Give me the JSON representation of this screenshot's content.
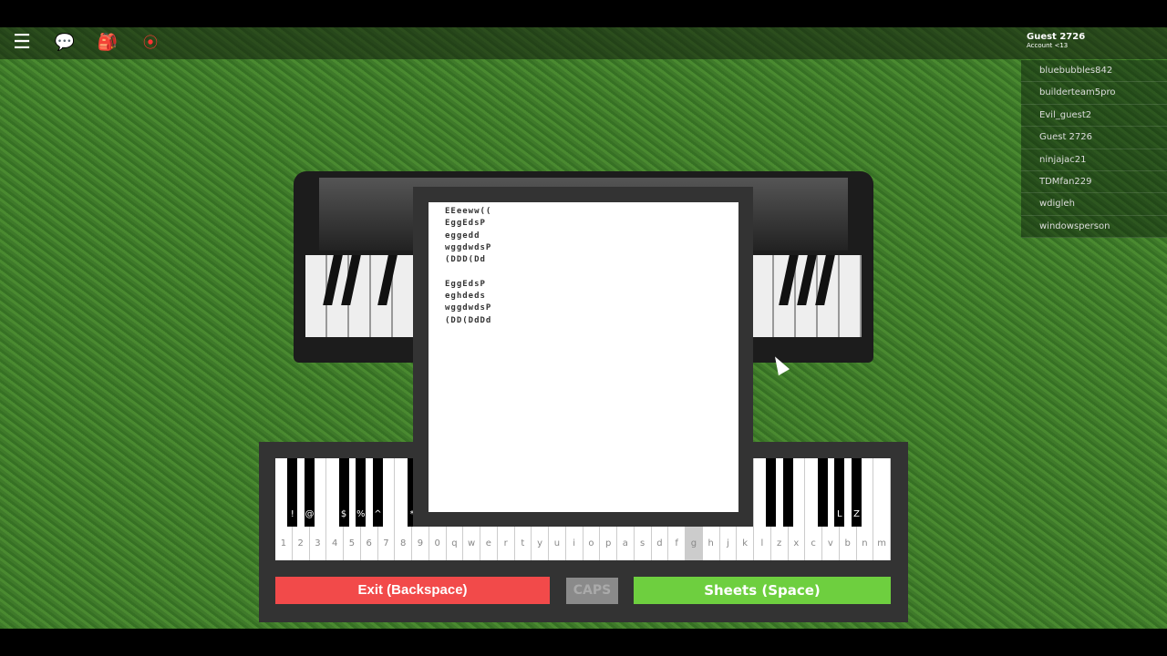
{
  "topbar": {
    "icons": [
      "menu-icon",
      "chat-icon",
      "backpack-icon",
      "record-icon"
    ]
  },
  "account": {
    "name": "Guest 2726",
    "subtitle": "Account <13"
  },
  "players": [
    "bluebubbles842",
    "builderteam5pro",
    "Evil_guest2",
    "Guest 2726",
    "ninjajac21",
    "TDMfan229",
    "wdigleh",
    "windowsperson"
  ],
  "sheet": {
    "lines": [
      "EEeeww((",
      "EggEdsP",
      "eggedd",
      "wggdwdsP",
      "(DDD(Dd",
      "",
      "EggEdsP",
      "eghdeds",
      "wggdwdsP",
      "(DD(DdDd"
    ]
  },
  "piano": {
    "white_keys": [
      "1",
      "2",
      "3",
      "4",
      "5",
      "6",
      "7",
      "8",
      "9",
      "0",
      "q",
      "w",
      "e",
      "r",
      "t",
      "y",
      "u",
      "i",
      "o",
      "p",
      "a",
      "s",
      "d",
      "f",
      "g",
      "h",
      "j",
      "k",
      "l",
      "z",
      "x",
      "c",
      "v",
      "b",
      "n",
      "m"
    ],
    "highlighted_key": "g",
    "black_keys": [
      "!",
      "@",
      "$",
      "%",
      "^",
      "*",
      "",
      "",
      "",
      "",
      "",
      "",
      "",
      "",
      "",
      "",
      "",
      "",
      "",
      "",
      "",
      "",
      "",
      "L",
      "Z",
      "C",
      "V",
      "B"
    ]
  },
  "buttons": {
    "exit": "Exit (Backspace)",
    "caps": "CAPS",
    "sheets": "Sheets (Space)"
  },
  "colors": {
    "exit": "#f24a4a",
    "sheets": "#6ecf3f",
    "caps": "#8a8a8a"
  }
}
